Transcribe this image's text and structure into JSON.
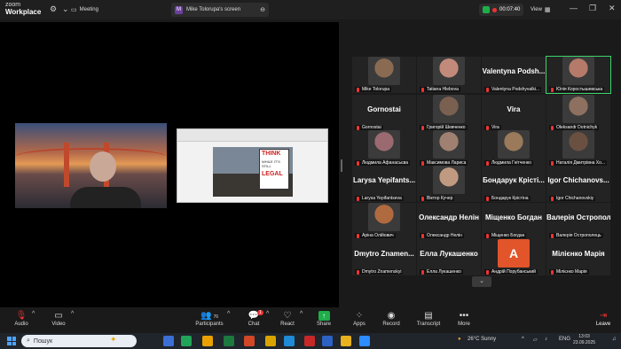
{
  "titlebar": {
    "logo_line1": "zoom",
    "logo_line2": "Workplace",
    "meeting_tab": "Meeting",
    "share_tab": "Mike Tolorupa's screen",
    "share_badge": "M",
    "timer": "00:07:40",
    "view": "View"
  },
  "share": {
    "sign_line1": "THINK",
    "sign_line2": "WHILE IT'S STILL",
    "sign_line3": "LEGAL"
  },
  "gallery": [
    {
      "big": "",
      "label": "Mike Tolorupa",
      "photo": "#8a6b52"
    },
    {
      "big": "",
      "label": "Tatiana Hlebova",
      "photo": "#c28a7a"
    },
    {
      "big": "Valentyna Podsh...",
      "label": "Valentyna Podshyvalki...",
      "photo": ""
    },
    {
      "big": "",
      "label": "Юлія Коростышевська",
      "photo": "#b57a6a"
    },
    {
      "big": "Gornostai",
      "label": "Gornostai",
      "photo": ""
    },
    {
      "big": "",
      "label": "Григорій Шевченко",
      "photo": "#7a6050"
    },
    {
      "big": "Vira",
      "label": "Vira",
      "photo": ""
    },
    {
      "big": "",
      "label": "Oleksandr Dotnichyk",
      "photo": "#8d7060"
    },
    {
      "big": "",
      "label": "Людмила Афанасьєва",
      "photo": "#9a6a70"
    },
    {
      "big": "",
      "label": "Максимова Лариса",
      "photo": "#a08070"
    },
    {
      "big": "",
      "label": "Людмила Гнітченко",
      "photo": "#9a7a5a"
    },
    {
      "big": "",
      "label": "Наталія Дмитрівна Хо...",
      "photo": "#6a5040"
    },
    {
      "big": "Larysa Yepifants...",
      "label": "Larysa Yepifantseva",
      "photo": ""
    },
    {
      "big": "",
      "label": "Віктор Кучер",
      "photo": "#c09a80"
    },
    {
      "big": "Бондарук Крісті...",
      "label": "Бондарук Крістіна",
      "photo": ""
    },
    {
      "big": "Igor Chichanovs...",
      "label": "Igor Chichanovskiy",
      "photo": ""
    },
    {
      "big": "",
      "label": "Аріна Олійович",
      "photo": "#b06a40"
    },
    {
      "big": "Олександр Нелін",
      "label": "Олександр Нелін",
      "photo": ""
    },
    {
      "big": "Міщенко Богдан",
      "label": "Міщенко Богдан",
      "photo": ""
    },
    {
      "big": "Валерія Острополь...",
      "label": "Валерія Острополець",
      "photo": ""
    },
    {
      "big": "Dmytro Znamen...",
      "label": "Dmytro Znamenskyi",
      "photo": ""
    },
    {
      "big": "Елла Лукашенко",
      "label": "Елла Лукашенко",
      "photo": ""
    },
    {
      "big": "A",
      "label": "Андрій Порубанський",
      "photo": "avatar"
    },
    {
      "big": "Мілієнко Марія",
      "label": "Мілієнко Марія",
      "photo": ""
    }
  ],
  "toolbar": {
    "audio": "Audio",
    "video": "Video",
    "participants": "Participants",
    "participants_count": "76",
    "chat": "Chat",
    "chat_badge": "1",
    "react": "React",
    "share": "Share",
    "apps": "Apps",
    "record": "Record",
    "transcript": "Transcript",
    "more": "More",
    "leave": "Leave"
  },
  "taskbar": {
    "search": "Пошук",
    "weather": "26°C  Sunny",
    "lang": "ENG",
    "time": "13:03",
    "date": "23.09.2025"
  },
  "colors": {
    "accent_green": "#1fae4a",
    "leave_red": "#e33333",
    "avatar_orange": "#e2542a"
  }
}
